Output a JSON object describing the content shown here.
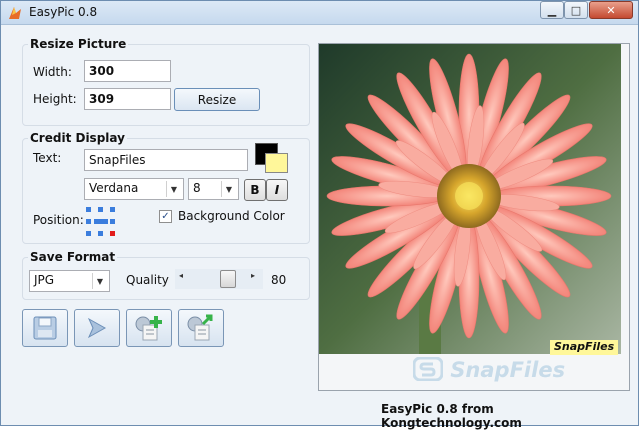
{
  "window": {
    "title": "EasyPic 0.8",
    "controls": [
      "minimize-icon",
      "maximize-icon",
      "close-icon"
    ]
  },
  "resize": {
    "group_title": "Resize Picture",
    "width_label": "Width:",
    "width_value": "300",
    "height_label": "Height:",
    "height_value": "309",
    "resize_button": "Resize"
  },
  "credit": {
    "group_title": "Credit Display",
    "text_label": "Text:",
    "text_value": "SnapFiles",
    "font": "Verdana",
    "size": "8",
    "bold_label": "B",
    "italic_label": "I",
    "position_label": "Position:",
    "background_label": "Background Color",
    "background_checked": true,
    "text_color": "#000000",
    "background_color": "#fff79a"
  },
  "save": {
    "group_title": "Save Format",
    "format": "JPG",
    "quality_label": "Quality",
    "quality_value": "80",
    "quality": 0.8
  },
  "toolbar": {
    "icons": [
      "save-icon",
      "send-icon",
      "add-settings-icon",
      "export-settings-icon"
    ]
  },
  "preview": {
    "credit_text": "SnapFiles",
    "watermark": "SnapFiles"
  },
  "footer": {
    "text": "EasyPic 0.8 from Kongtechnology.com"
  }
}
